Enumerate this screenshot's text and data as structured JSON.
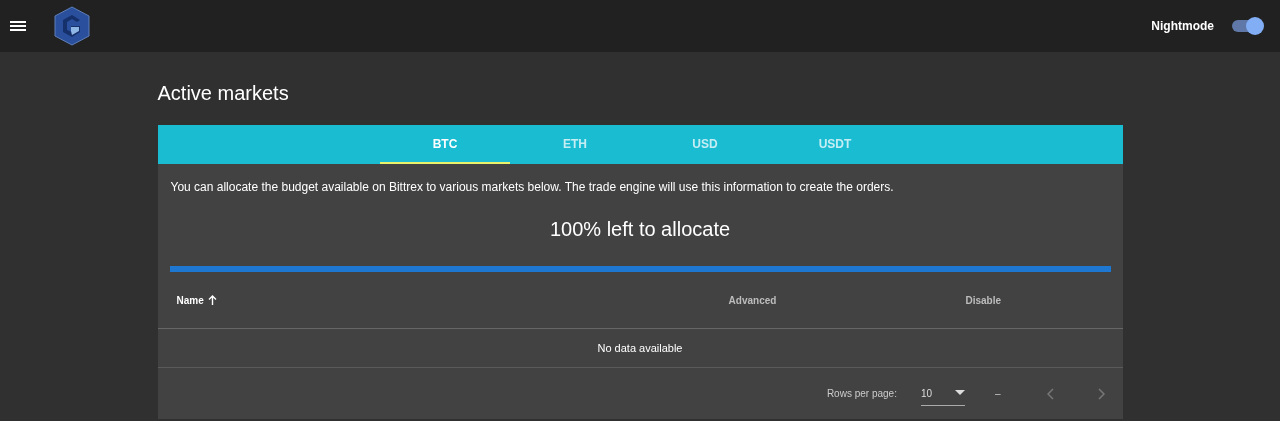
{
  "header": {
    "nightmode": {
      "label": "Nightmode",
      "on": true
    }
  },
  "page": {
    "title": "Active markets"
  },
  "tabs": [
    {
      "label": "BTC",
      "selected": true
    },
    {
      "label": "ETH",
      "selected": false
    },
    {
      "label": "USD",
      "selected": false
    },
    {
      "label": "USDT",
      "selected": false
    }
  ],
  "info": "You can allocate the budget available on Bittrex to various markets below. The trade engine will use this information to create the orders.",
  "allocation": {
    "text": "100% left to allocate",
    "level": 1
  },
  "table": {
    "columns": [
      {
        "label": "Name",
        "sorted": true
      },
      {
        "label": "Advanced",
        "sorted": false
      },
      {
        "label": "Disable",
        "sorted": false
      }
    ],
    "empty": "No data available",
    "footer": {
      "rows_per_page_label": "Rows per page:",
      "rows_per_page": "10",
      "range": "–",
      "prev_disabled": true,
      "next_disabled": true
    }
  }
}
